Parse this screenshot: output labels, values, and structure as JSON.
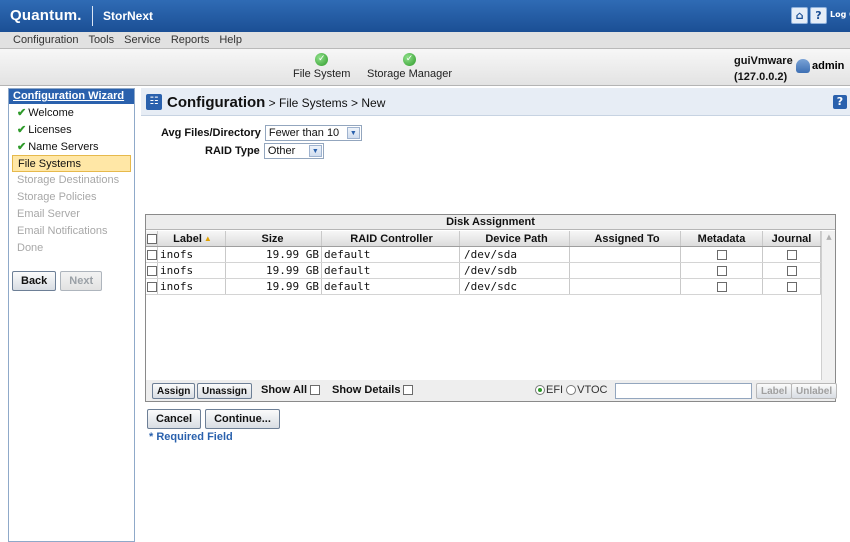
{
  "header": {
    "brand": "Quantum.",
    "product": "StorNext",
    "home_icon": "home-icon",
    "help_icon": "help-icon",
    "logoff_label": "Log Off"
  },
  "menu": [
    "Configuration",
    "Tools",
    "Service",
    "Reports",
    "Help"
  ],
  "status": {
    "services": [
      {
        "label": "File System",
        "state": "ok"
      },
      {
        "label": "Storage Manager",
        "state": "ok"
      }
    ],
    "host_name": "guiVmware",
    "host_ip": "(127.0.0.2)",
    "user": "admin"
  },
  "wizard": {
    "title": "Configuration Wizard",
    "steps": [
      {
        "label": "Welcome",
        "state": "done"
      },
      {
        "label": "Licenses",
        "state": "done"
      },
      {
        "label": "Name Servers",
        "state": "done"
      },
      {
        "label": "File Systems",
        "state": "current"
      },
      {
        "label": "Storage Destinations",
        "state": "pending"
      },
      {
        "label": "Storage Policies",
        "state": "pending"
      },
      {
        "label": "Email Server",
        "state": "pending"
      },
      {
        "label": "Email Notifications",
        "state": "pending"
      },
      {
        "label": "Done",
        "state": "pending"
      }
    ],
    "back_label": "Back",
    "next_label": "Next"
  },
  "page": {
    "crumb_root": "Configuration",
    "crumb_rest": " > File Systems > New"
  },
  "form": {
    "avg_files_label": "Avg Files/Directory",
    "avg_files_value": "Fewer than 10",
    "raid_type_label": "RAID Type",
    "raid_type_value": "Other"
  },
  "disk_assignment": {
    "title": "Disk Assignment",
    "columns": [
      "Label",
      "Size",
      "RAID Controller",
      "Device Path",
      "Assigned To",
      "Metadata",
      "Journal"
    ],
    "rows": [
      {
        "label": "inofs",
        "size": "19.99 GB",
        "raid": "default",
        "path": "/dev/sda",
        "assigned": "",
        "metadata": false,
        "journal": false
      },
      {
        "label": "inofs",
        "size": "19.99 GB",
        "raid": "default",
        "path": "/dev/sdb",
        "assigned": "",
        "metadata": false,
        "journal": false
      },
      {
        "label": "inofs",
        "size": "19.99 GB",
        "raid": "default",
        "path": "/dev/sdc",
        "assigned": "",
        "metadata": false,
        "journal": false
      }
    ],
    "assign_label": "Assign",
    "unassign_label": "Unassign",
    "show_all_label": "Show All",
    "show_details_label": "Show Details",
    "efi_label": "EFI",
    "vtoc_label": "VTOC",
    "label_button": "Label",
    "unlabel_button": "Unlabel"
  },
  "actions": {
    "cancel_label": "Cancel",
    "continue_label": "Continue...",
    "required_note": "* Required Field"
  }
}
